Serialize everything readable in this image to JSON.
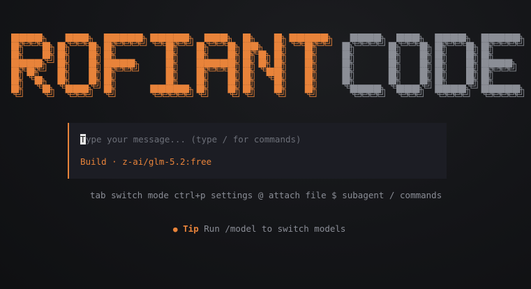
{
  "logo": {
    "word1": "ROFIANT",
    "word2": "CODE",
    "word1_color": "#e8833a",
    "word2_color": "#8b8e96"
  },
  "prompt": {
    "cursor_char": "T",
    "placeholder_rest": "ype your message... (type / for commands)",
    "mode": "Build",
    "separator": "·",
    "model": "z-ai/glm-5.2:free"
  },
  "hints": {
    "text": "tab switch mode ctrl+p settings @ attach file $ subagent / commands"
  },
  "tip": {
    "label": "Tip",
    "text": "Run /model to switch models"
  }
}
